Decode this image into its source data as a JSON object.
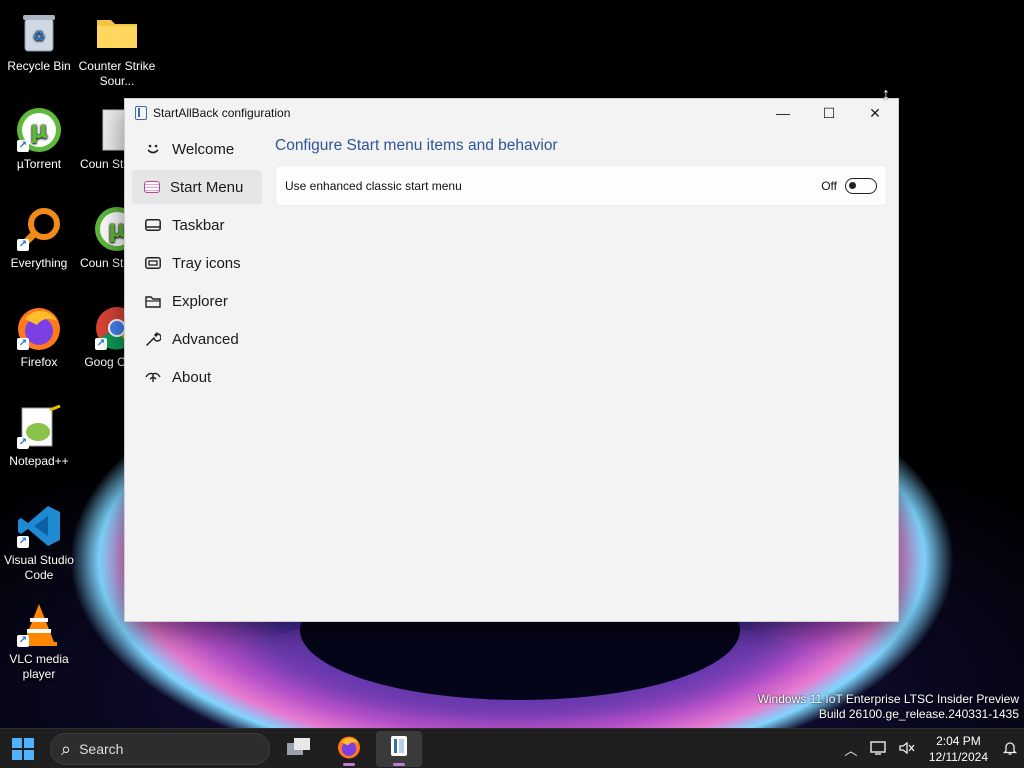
{
  "desktop": {
    "icons": [
      {
        "label": "Recycle Bin",
        "icon": "recycle-bin-icon"
      },
      {
        "label": "Counter Strike Sour...",
        "icon": "folder-icon"
      },
      {
        "label": "µTorrent",
        "icon": "utorrent-icon"
      },
      {
        "label": "Coun Strike S",
        "icon": "file-icon"
      },
      {
        "label": "Everything",
        "icon": "everything-search-icon"
      },
      {
        "label": "Coun Strike S",
        "icon": "utorrent-icon"
      },
      {
        "label": "Firefox",
        "icon": "firefox-icon"
      },
      {
        "label": "Goog Chron",
        "icon": "chrome-icon"
      },
      {
        "label": "Notepad++",
        "icon": "notepadpp-icon"
      },
      {
        "label": "Visual Studio Code",
        "icon": "vscode-icon"
      },
      {
        "label": "VLC media player",
        "icon": "vlc-icon"
      }
    ],
    "watermark_line1": "Windows 11 IoT Enterprise LTSC Insider Preview",
    "watermark_line2": "Build 26100.ge_release.240331-1435"
  },
  "window": {
    "title": "StartAllBack configuration",
    "controls": {
      "minimize": "—",
      "maximize": "☐",
      "close": "✕"
    }
  },
  "sidebar": {
    "items": [
      {
        "label": "Welcome",
        "icon": "smiley-icon",
        "active": false
      },
      {
        "label": "Start Menu",
        "icon": "start-menu-icon",
        "active": true
      },
      {
        "label": "Taskbar",
        "icon": "taskbar-icon",
        "active": false
      },
      {
        "label": "Tray icons",
        "icon": "tray-icon",
        "active": false
      },
      {
        "label": "Explorer",
        "icon": "folder-icon",
        "active": false
      },
      {
        "label": "Advanced",
        "icon": "wrench-icon",
        "active": false
      },
      {
        "label": "About",
        "icon": "about-icon",
        "active": false
      }
    ]
  },
  "content": {
    "title": "Configure Start menu items and behavior",
    "settings": [
      {
        "label": "Use enhanced classic start menu",
        "state": "Off"
      }
    ]
  },
  "taskbar": {
    "search_label": "Search",
    "apps": [
      "task-view-icon",
      "firefox-icon",
      "startallback-icon"
    ],
    "clock_time": "2:04 PM",
    "clock_date": "12/11/2024"
  },
  "colors": {
    "accent_title": "#2f5596",
    "window_bg": "#f3f3f3",
    "taskbar_bg": "#1f1f1f"
  }
}
